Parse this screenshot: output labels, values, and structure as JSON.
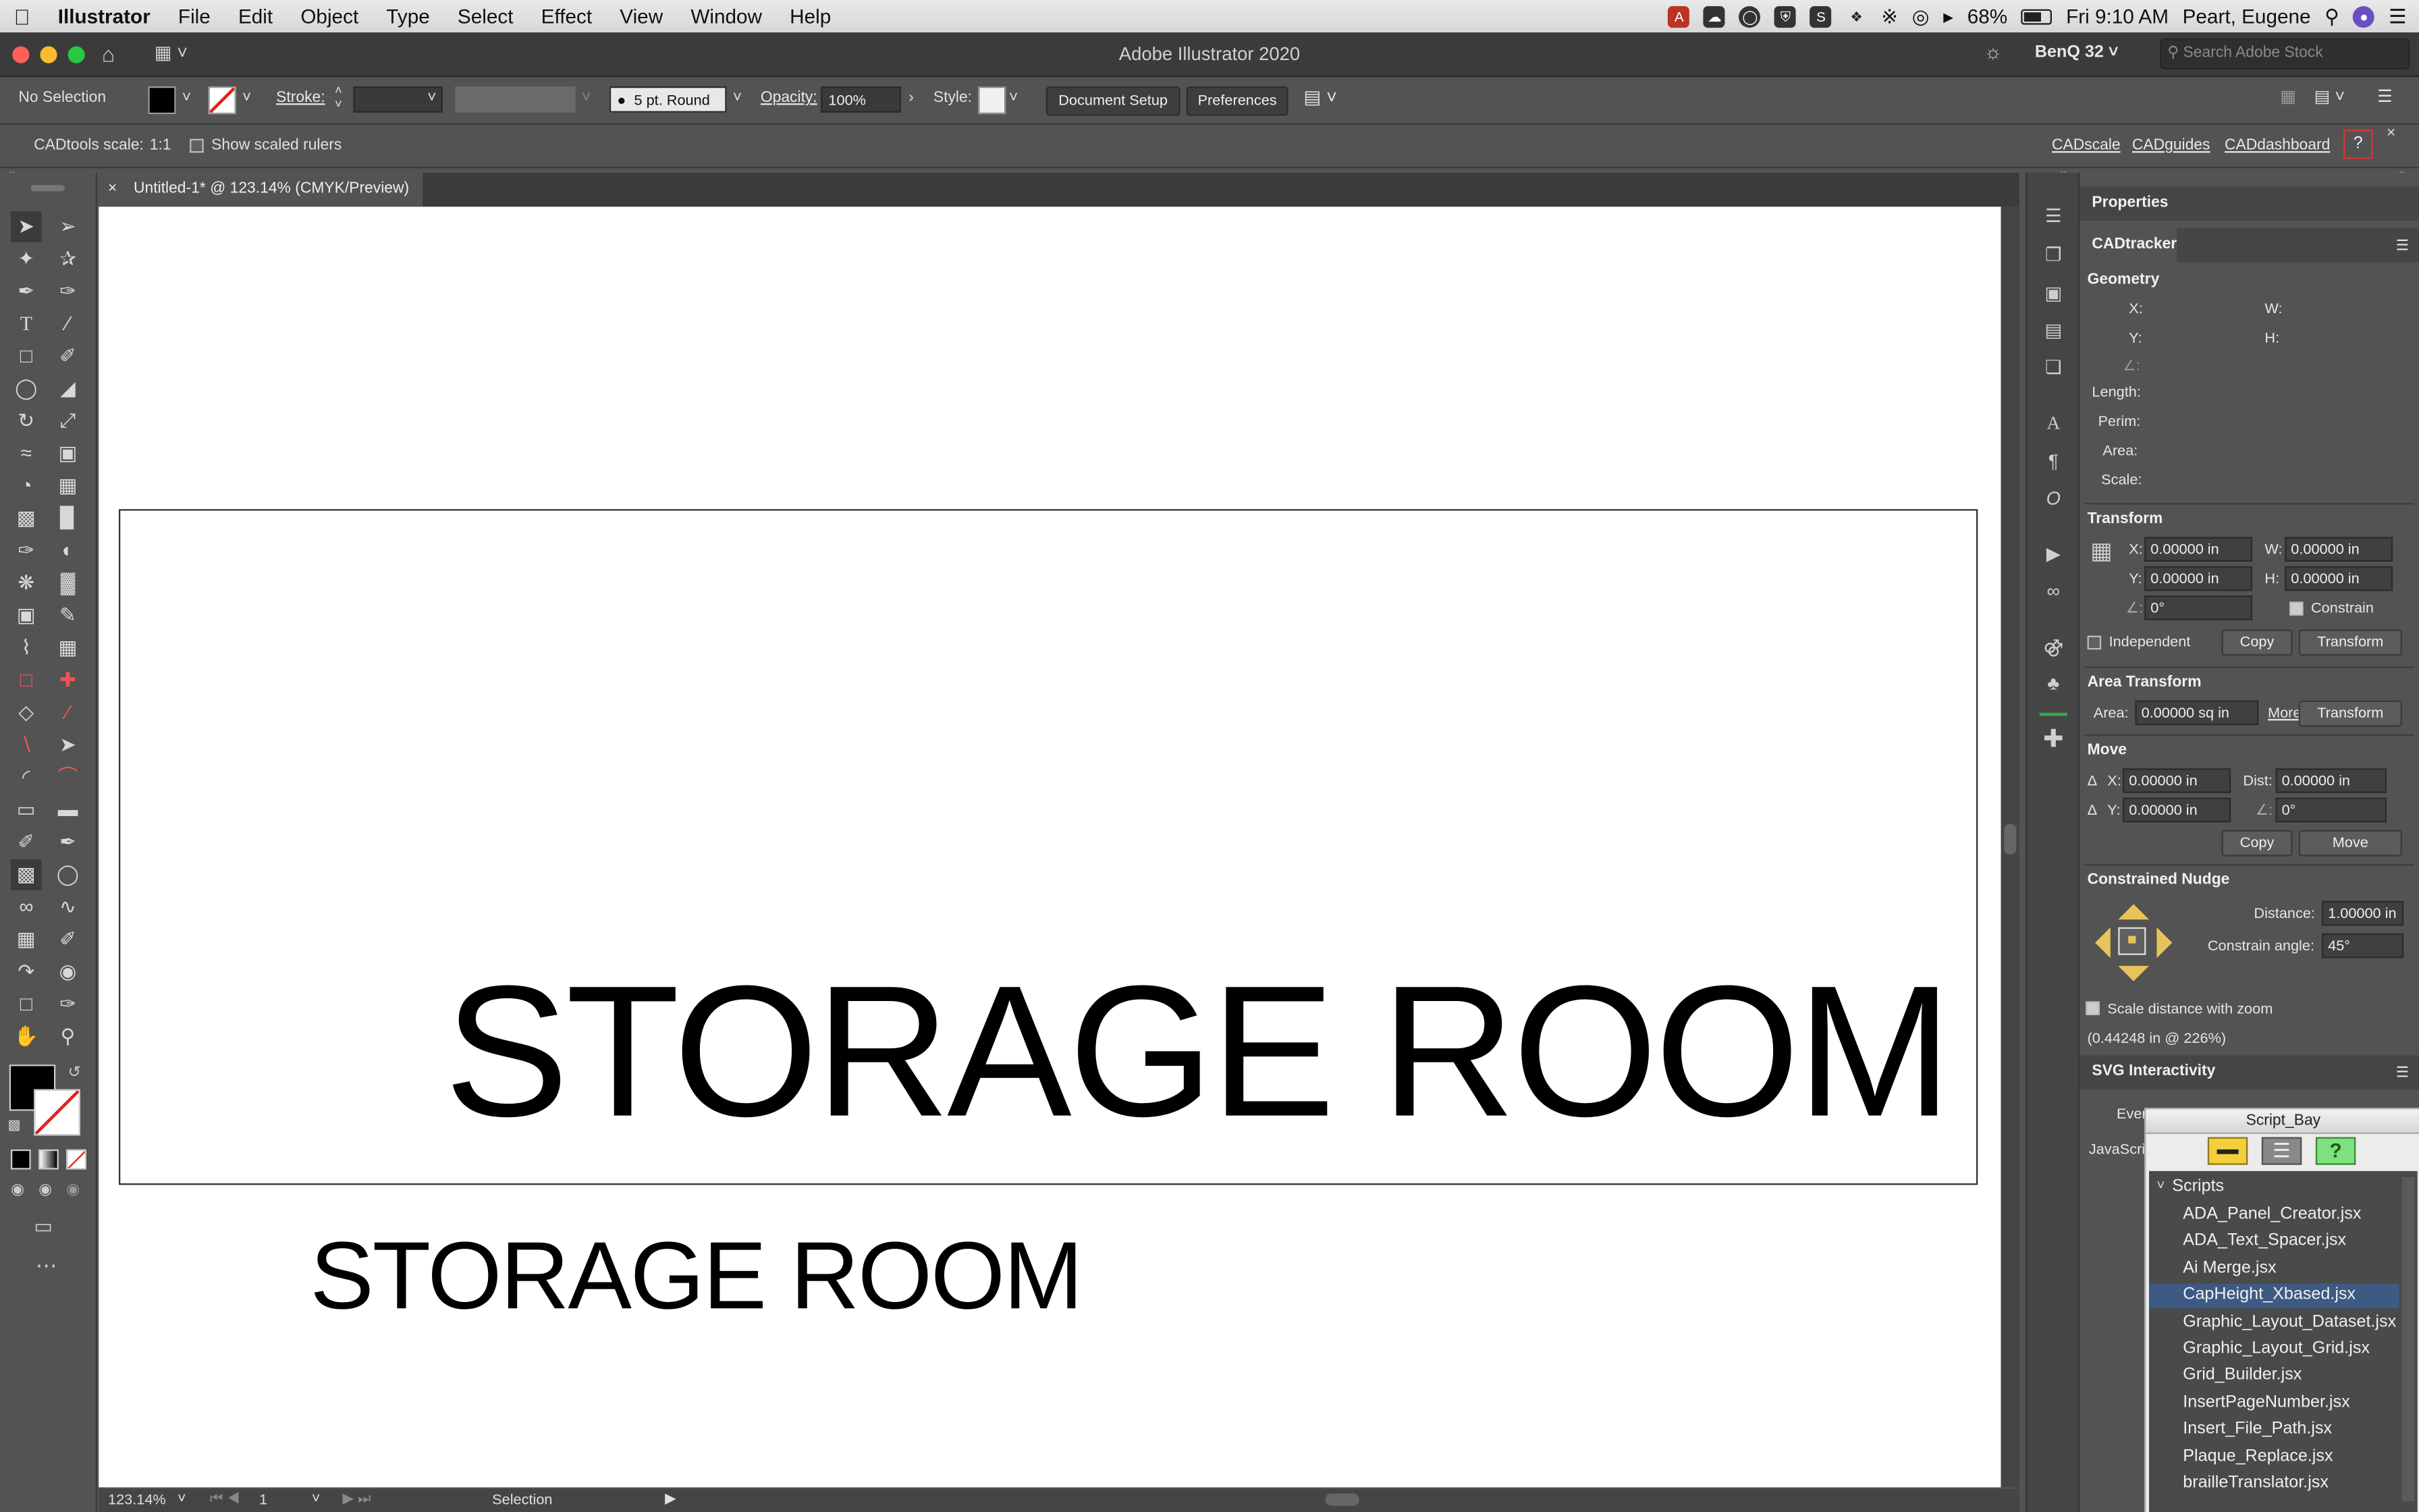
{
  "menubar": {
    "items": [
      "Illustrator",
      "File",
      "Edit",
      "Object",
      "Type",
      "Select",
      "Effect",
      "View",
      "Window",
      "Help"
    ],
    "battery": "68%",
    "datetime": "Fri 9:10 AM",
    "user": "Peart, Eugene"
  },
  "titlebar": {
    "title": "Adobe Illustrator 2020",
    "workspace": "BenQ 32",
    "search_placeholder": "Search Adobe Stock"
  },
  "controlbar": {
    "selection": "No Selection",
    "stroke_label": "Stroke:",
    "brush": "5 pt. Round",
    "opacity_label": "Opacity:",
    "opacity_value": "100%",
    "style_label": "Style:",
    "document_setup": "Document Setup",
    "preferences": "Preferences"
  },
  "cadbar": {
    "scale_label": "CADtools scale:",
    "scale_value": "1:1",
    "show_rulers": "Show scaled rulers",
    "links": [
      "CADscale",
      "CADguides",
      "CADdashboard"
    ],
    "help": "?"
  },
  "document": {
    "tab_title": "Untitled-1* @ 123.14% (CMYK/Preview)",
    "big_text": "STORAGE ROOM",
    "small_text": "STORAGE ROOM"
  },
  "statusbar": {
    "zoom": "123.14%",
    "artboard": "1",
    "tool": "Selection"
  },
  "panel": {
    "properties_tab": "Properties",
    "cadtracker_tab": "CADtracker",
    "geometry": {
      "title": "Geometry",
      "x": "X:",
      "w": "W:",
      "y": "Y:",
      "h": "H:",
      "length": "Length:",
      "perim": "Perim:",
      "area": "Area:",
      "scale": "Scale:"
    },
    "transform": {
      "title": "Transform",
      "x_label": "X:",
      "x_value": "0.00000 in",
      "w_label": "W:",
      "w_value": "0.00000 in",
      "y_label": "Y:",
      "y_value": "0.00000 in",
      "h_label": "H:",
      "h_value": "0.00000 in",
      "angle": "0°",
      "constrain": "Constrain",
      "independent": "Independent",
      "copy": "Copy",
      "transform_btn": "Transform"
    },
    "area_transform": {
      "title": "Area Transform",
      "area_label": "Area:",
      "area_value": "0.00000 sq in",
      "more": "More...",
      "transform_btn": "Transform"
    },
    "move": {
      "title": "Move",
      "x_label": "X:",
      "x_value": "0.00000 in",
      "dist_label": "Dist:",
      "dist_value": "0.00000 in",
      "y_label": "Y:",
      "y_value": "0.00000 in",
      "angle": "0°",
      "copy": "Copy",
      "move_btn": "Move"
    },
    "nudge": {
      "title": "Constrained Nudge",
      "distance_label": "Distance:",
      "distance_value": "1.00000 in",
      "angle_label": "Constrain angle:",
      "angle_value": "45°",
      "scale_zoom": "Scale distance with zoom",
      "info": "(0.44248 in @ 226%)"
    },
    "svg_tab": "SVG Interactivity",
    "svg_event": "Even",
    "svg_js": "JavaScrip"
  },
  "scriptbay": {
    "title": "Script_Bay",
    "folder": "Scripts",
    "selected_index": 3,
    "scripts": [
      "ADA_Panel_Creator.jsx",
      "ADA_Text_Spacer.jsx",
      "Ai Merge.jsx",
      "CapHeight_Xbased.jsx",
      "Graphic_Layout_Dataset.jsx",
      "Graphic_Layout_Grid.jsx",
      "Grid_Builder.jsx",
      "InsertPageNumber.jsx",
      "Insert_File_Path.jsx",
      "Plaque_Replace.jsx",
      "brailleTranslator.jsx"
    ]
  },
  "colors": {
    "ui_bg": "#535353",
    "canvas": "#ffffff",
    "selected_row": "#3c5a82",
    "nudge_arrow": "#e8c35a"
  }
}
